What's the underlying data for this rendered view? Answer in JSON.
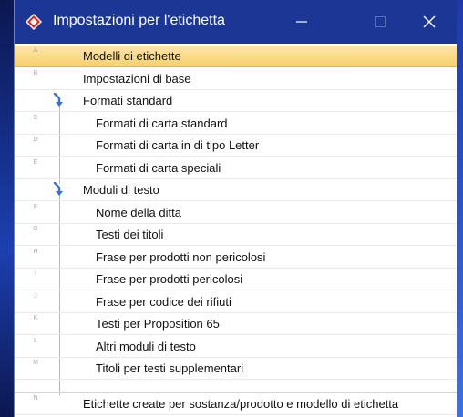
{
  "window": {
    "title": "Impostazioni per l'etichetta",
    "titlebar_color": "#1c3695",
    "icon": "app-diamond-icon",
    "buttons": {
      "minimize": "minimize-icon",
      "maximize": "maximize-icon",
      "close": "close-icon"
    }
  },
  "colors": {
    "selected_row": "#f7cf6d",
    "letter": "#a8a8a8"
  },
  "items": [
    {
      "letter": "A",
      "label": "Modelli di etichette",
      "selected": true
    },
    {
      "letter": "B",
      "label": "Impostazioni di base"
    },
    {
      "letter": "",
      "label": "Formati standard",
      "group": true
    },
    {
      "letter": "C",
      "label": "Formati di carta standard"
    },
    {
      "letter": "D",
      "label": "Formati di carta in di tipo Letter"
    },
    {
      "letter": "E",
      "label": "Formati di carta speciali"
    },
    {
      "letter": "",
      "label": "Moduli di testo",
      "group": true
    },
    {
      "letter": "F",
      "label": "Nome della ditta"
    },
    {
      "letter": "G",
      "label": "Testi dei titoli"
    },
    {
      "letter": "H",
      "label": "Frase per prodotti non pericolosi"
    },
    {
      "letter": "I",
      "label": "Frase per prodotti pericolosi"
    },
    {
      "letter": "J",
      "label": "Frase per codice dei rifiuti"
    },
    {
      "letter": "K",
      "label": "Testi per Proposition 65"
    },
    {
      "letter": "L",
      "label": "Altri moduli di testo"
    },
    {
      "letter": "M",
      "label": "Titoli per testi supplementari"
    },
    {
      "letter": "N",
      "label": "Etichette create per sostanza/prodotto e modello di etichetta"
    }
  ]
}
